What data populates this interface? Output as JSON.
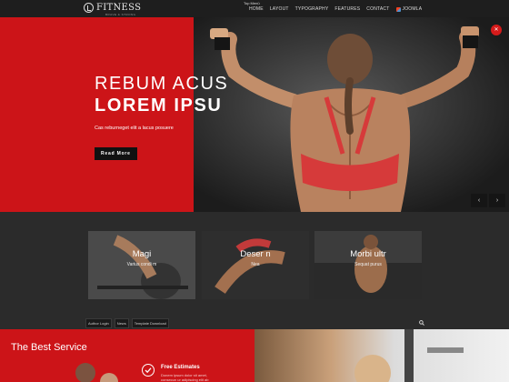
{
  "header": {
    "logo_text": "FITNESS",
    "logo_subtext": "BRAVE & STRONG",
    "top_menu_label": "Top Menü",
    "nav": [
      {
        "label": "HOME"
      },
      {
        "label": "LAYOUT"
      },
      {
        "label": "TYPOGRAPHY"
      },
      {
        "label": "FEATURES"
      },
      {
        "label": "CONTACT"
      },
      {
        "label": "JOOMLA"
      }
    ]
  },
  "hero": {
    "title_line1": "REBUM ACUS",
    "title_line2": "LOREM IPSU",
    "subtitle": "Cas reburneget elit a lacus posuere",
    "button_label": "Read More",
    "prev_arrow": "‹",
    "next_arrow": "›",
    "badge": "✕"
  },
  "features": [
    {
      "title": "Magi",
      "text": "Varius condi m"
    },
    {
      "title": "Deser n",
      "text": "Nea"
    },
    {
      "title": "Morbi ultr",
      "text": "Sequat purus"
    }
  ],
  "footer_links": [
    "Author Login",
    "News",
    "Template Download"
  ],
  "service": {
    "title": "The Best Service",
    "item_title": "Free Estimates",
    "item_text_line1": "Donem ipsum dolor sit amet,",
    "item_text_line2": "consecun ur adipiscing elit ab"
  },
  "colors": {
    "accent": "#cc1418",
    "dark": "#2b2b2b",
    "nav_bg": "#1e1e1e"
  }
}
